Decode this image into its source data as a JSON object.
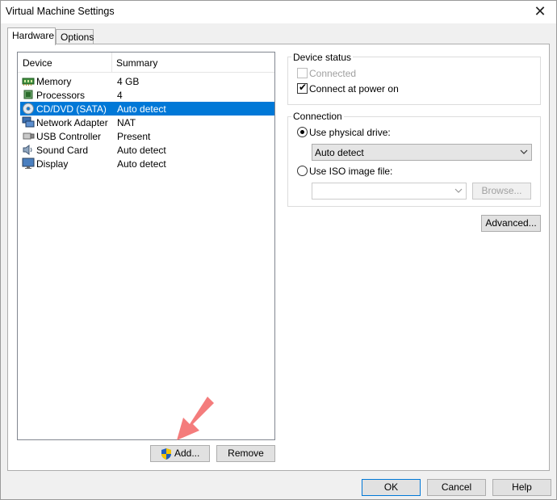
{
  "window": {
    "title": "Virtual Machine Settings",
    "close_glyph": "✕"
  },
  "tabs": [
    {
      "label": "Hardware",
      "active": true
    },
    {
      "label": "Options",
      "active": false
    }
  ],
  "device_list": {
    "columns": [
      "Device",
      "Summary"
    ],
    "rows": [
      {
        "name": "Memory",
        "summary": "4 GB",
        "icon": "memory-icon",
        "selected": false
      },
      {
        "name": "Processors",
        "summary": "4",
        "icon": "processor-icon",
        "selected": false
      },
      {
        "name": "CD/DVD (SATA)",
        "summary": "Auto detect",
        "icon": "cd-dvd-icon",
        "selected": true
      },
      {
        "name": "Network Adapter",
        "summary": "NAT",
        "icon": "network-adapter-icon",
        "selected": false
      },
      {
        "name": "USB Controller",
        "summary": "Present",
        "icon": "usb-icon",
        "selected": false
      },
      {
        "name": "Sound Card",
        "summary": "Auto detect",
        "icon": "sound-card-icon",
        "selected": false
      },
      {
        "name": "Display",
        "summary": "Auto detect",
        "icon": "display-icon",
        "selected": false
      }
    ]
  },
  "list_buttons": {
    "add": "Add...",
    "remove": "Remove"
  },
  "device_status": {
    "label": "Device status",
    "connected": {
      "label": "Connected",
      "checked": false,
      "enabled": false
    },
    "connect_at_power_on": {
      "label": "Connect at power on",
      "checked": true,
      "enabled": true
    }
  },
  "connection": {
    "label": "Connection",
    "physical_drive": {
      "label": "Use physical drive:",
      "selected": true,
      "value": "Auto detect"
    },
    "iso_image": {
      "label": "Use ISO image file:",
      "selected": false,
      "value": "",
      "browse": "Browse..."
    }
  },
  "advanced_button": "Advanced...",
  "footer": {
    "ok": "OK",
    "cancel": "Cancel",
    "help": "Help"
  },
  "colors": {
    "selection": "#0078d7",
    "annotation_arrow": "#f47c7c",
    "shield_blue": "#1f5fbf",
    "shield_yellow": "#f5c400"
  }
}
